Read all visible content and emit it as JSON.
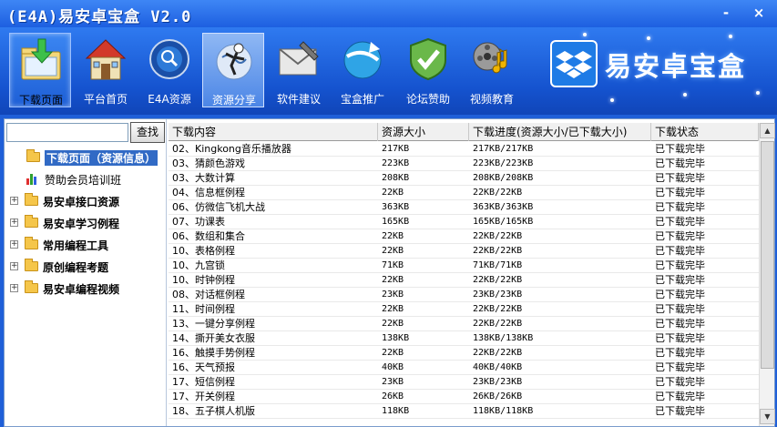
{
  "window": {
    "title": "(E4A)易安卓宝盒 V2.0",
    "minimize": "-",
    "close": "×"
  },
  "toolbar": {
    "items": [
      {
        "label": "下载页面",
        "icon": "download-folder-icon"
      },
      {
        "label": "平台首页",
        "icon": "house-icon"
      },
      {
        "label": "E4A资源",
        "icon": "globe-search-icon"
      },
      {
        "label": "资源分享",
        "icon": "share-globe-icon"
      },
      {
        "label": "软件建议",
        "icon": "envelope-pen-icon"
      },
      {
        "label": "宝盒推广",
        "icon": "promotion-globe-icon"
      },
      {
        "label": "论坛赞助",
        "icon": "shield-check-icon"
      },
      {
        "label": "视频教育",
        "icon": "film-music-icon"
      }
    ],
    "brand": "易安卓宝盒"
  },
  "sidebar": {
    "search_button": "查找",
    "search_value": "",
    "tree": [
      {
        "label": "下载页面（资源信息）",
        "selected": true
      },
      {
        "label": "赞助会员培训班"
      },
      {
        "label": "易安卓接口资源"
      },
      {
        "label": "易安卓学习例程"
      },
      {
        "label": "常用编程工具"
      },
      {
        "label": "原创编程考题"
      },
      {
        "label": "易安卓编程视频"
      }
    ]
  },
  "table": {
    "headers": [
      "下载内容",
      "资源大小",
      "下载进度(资源大小/已下载大小)",
      "下载状态"
    ],
    "rows": [
      [
        "02、Kingkong音乐播放器",
        "217KB",
        "217KB/217KB",
        "已下载完毕"
      ],
      [
        "03、猜颜色游戏",
        "223KB",
        "223KB/223KB",
        "已下载完毕"
      ],
      [
        "03、大数计算",
        "208KB",
        "208KB/208KB",
        "已下载完毕"
      ],
      [
        "04、信息框例程",
        "22KB",
        "22KB/22KB",
        "已下载完毕"
      ],
      [
        "06、仿微信飞机大战",
        "363KB",
        "363KB/363KB",
        "已下载完毕"
      ],
      [
        "07、功课表",
        "165KB",
        "165KB/165KB",
        "已下载完毕"
      ],
      [
        "06、数组和集合",
        "22KB",
        "22KB/22KB",
        "已下载完毕"
      ],
      [
        "10、表格例程",
        "22KB",
        "22KB/22KB",
        "已下载完毕"
      ],
      [
        "10、九宫锁",
        "71KB",
        "71KB/71KB",
        "已下载完毕"
      ],
      [
        "10、时钟例程",
        "22KB",
        "22KB/22KB",
        "已下载完毕"
      ],
      [
        "08、对话框例程",
        "23KB",
        "23KB/23KB",
        "已下载完毕"
      ],
      [
        "11、时间例程",
        "22KB",
        "22KB/22KB",
        "已下载完毕"
      ],
      [
        "13、一键分享例程",
        "22KB",
        "22KB/22KB",
        "已下载完毕"
      ],
      [
        "14、撕开美女衣服",
        "138KB",
        "138KB/138KB",
        "已下载完毕"
      ],
      [
        "16、触摸手势例程",
        "22KB",
        "22KB/22KB",
        "已下载完毕"
      ],
      [
        "16、天气预报",
        "40KB",
        "40KB/40KB",
        "已下载完毕"
      ],
      [
        "17、短信例程",
        "23KB",
        "23KB/23KB",
        "已下载完毕"
      ],
      [
        "17、开关例程",
        "26KB",
        "26KB/26KB",
        "已下载完毕"
      ],
      [
        "18、五子棋人机版",
        "118KB",
        "118KB/118KB",
        "已下载完毕"
      ]
    ]
  },
  "colors": {
    "title_bar": "#1d5fe0",
    "toolbar": "#1553cf",
    "selection": "#316ac5",
    "folder": "#f5c64a"
  }
}
